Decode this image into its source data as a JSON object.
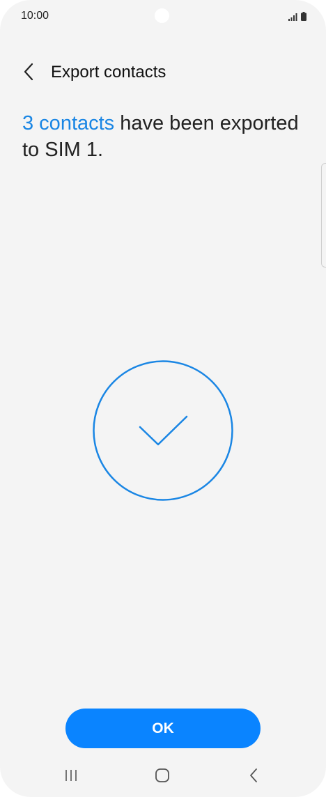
{
  "status_bar": {
    "time": "10:00",
    "icons": [
      "signal-icon",
      "battery-icon"
    ]
  },
  "header": {
    "back_icon": "chevron-left-icon",
    "title": "Export contacts"
  },
  "message": {
    "link_text": "3 contacts",
    "text": " have been exported to SIM 1."
  },
  "result": {
    "icon": "checkmark-circle-icon"
  },
  "actions": {
    "ok_label": "OK"
  },
  "nav_bar": {
    "icons": [
      "recent-apps-icon",
      "home-icon",
      "back-icon"
    ]
  },
  "colors": {
    "accent": "#1a86e4",
    "button": "#0a84ff",
    "background": "#f4f4f4",
    "text": "#222222"
  }
}
